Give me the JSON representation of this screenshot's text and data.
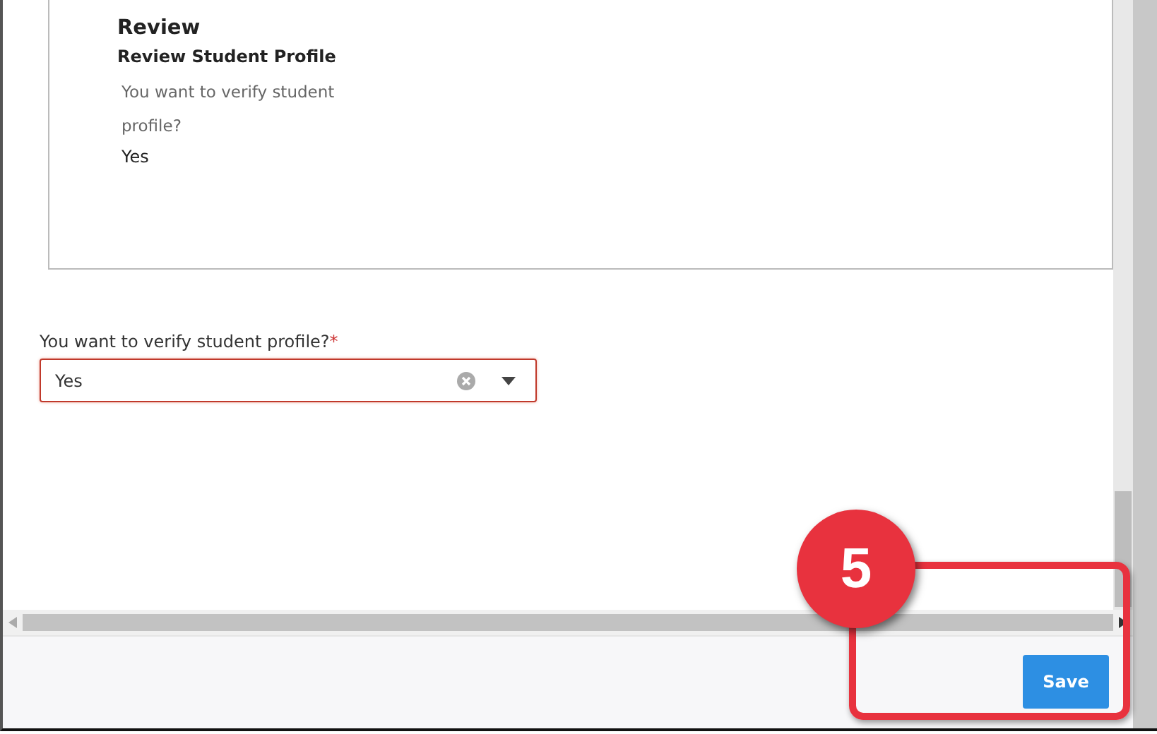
{
  "review": {
    "title": "Review",
    "subtitle": "Review Student Profile",
    "question": "You want to verify student profile?",
    "answer": "Yes"
  },
  "field": {
    "label": "You want to verify student profile?",
    "required": true,
    "required_mark": "*",
    "value": "Yes"
  },
  "footer": {
    "button": "Save"
  },
  "callout": {
    "step": "5"
  }
}
